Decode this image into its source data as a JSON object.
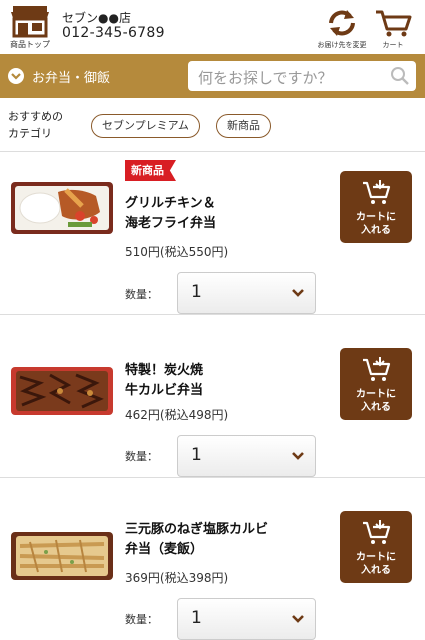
{
  "header": {
    "home_label": "商品トップ",
    "store_name": "セブン●●店",
    "store_phone": "012-345-6789",
    "delivery_label": "お届け先を変更",
    "cart_label": "カート"
  },
  "category_bar": {
    "category_label": "お弁当・御飯",
    "search_placeholder": "何をお探しですか？"
  },
  "recommended": {
    "label": "おすすめの\nカテゴリ",
    "chips": [
      "セブンプレミアム",
      "新商品"
    ]
  },
  "colors": {
    "brand_gold": "#b58a3c",
    "cart_button": "#6e3a15",
    "new_badge": "#d81e23"
  },
  "products": [
    {
      "badge": "新商品",
      "name_line1": "グリルチキン＆",
      "name_line2": "海老フライ弁当",
      "price": "510円(税込550円)",
      "qty_label": "数量：",
      "qty_value": "1",
      "cart_button": "カートに\n入れる"
    },
    {
      "badge": "",
      "name_line1": "特製！炭火焼",
      "name_line2": "牛カルビ弁当",
      "price": "462円(税込498円)",
      "qty_label": "数量：",
      "qty_value": "1",
      "cart_button": "カートに\n入れる"
    },
    {
      "badge": "",
      "name_line1": "三元豚のねぎ塩豚カルビ",
      "name_line2": "弁当（麦飯）",
      "price": "369円(税込398円)",
      "qty_label": "数量：",
      "qty_value": "1",
      "cart_button": "カートに\n入れる"
    }
  ]
}
